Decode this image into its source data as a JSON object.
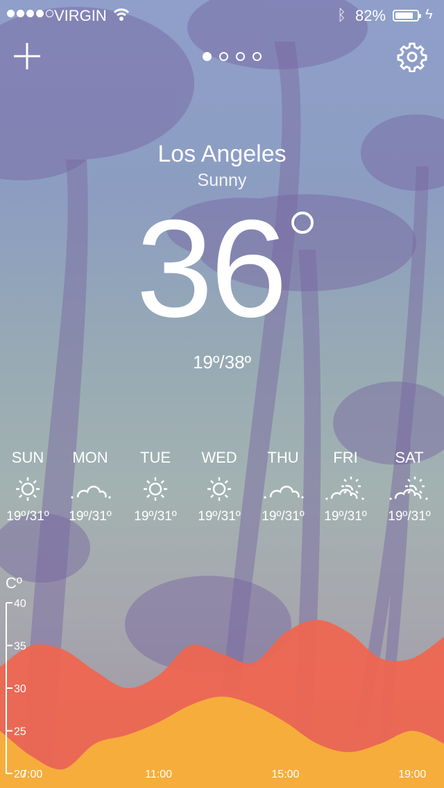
{
  "status_bar": {
    "carrier": "VIRGIN",
    "signal_bars": 4,
    "signal_max": 5,
    "battery_percent": "82%",
    "battery_level": 0.82
  },
  "nav": {
    "add_icon": "plus-icon",
    "settings_icon": "gear-icon",
    "pages": 4,
    "active_page": 0
  },
  "current": {
    "city": "Los Angeles",
    "condition": "Sunny",
    "temperature": "36",
    "range": "19º/38º"
  },
  "forecast": [
    {
      "day": "SUN",
      "icon": "sun-icon",
      "range": "19º/31º"
    },
    {
      "day": "MON",
      "icon": "cloud-icon",
      "range": "19º/31º"
    },
    {
      "day": "TUE",
      "icon": "sun-icon",
      "range": "19º/31º"
    },
    {
      "day": "WED",
      "icon": "sun-icon",
      "range": "19º/31º"
    },
    {
      "day": "THU",
      "icon": "cloud-icon",
      "range": "19º/31º"
    },
    {
      "day": "FRI",
      "icon": "partly-cloudy-icon",
      "range": "19º/31º"
    },
    {
      "day": "SAT",
      "icon": "partly-cloudy-icon",
      "range": "19º/31º"
    }
  ],
  "chart_data": {
    "type": "area",
    "ylabel": "Cº",
    "ylim": [
      20,
      40
    ],
    "yticks": [
      "40",
      "35",
      "30",
      "25",
      "20"
    ],
    "xtick_labels": [
      {
        "x": 7,
        "label": "7:00"
      },
      {
        "x": 11,
        "label": "11:00"
      },
      {
        "x": 15,
        "label": "15:00"
      },
      {
        "x": 19,
        "label": "19:00"
      }
    ],
    "x": [
      6,
      7,
      8,
      9,
      10,
      11,
      12,
      13,
      14,
      15,
      16,
      17,
      18,
      19,
      20
    ],
    "series": [
      {
        "color": "#f0654f",
        "values": [
          32.5,
          35,
          34.5,
          32,
          30,
          31.5,
          35,
          34,
          33,
          36.5,
          38,
          36.5,
          33.5,
          33.5,
          36
        ]
      },
      {
        "color": "#f6b33a",
        "values": [
          25,
          22,
          20.5,
          23.5,
          24.5,
          26,
          28,
          29,
          28,
          26,
          23.5,
          22.5,
          23.5,
          25,
          23.5
        ]
      }
    ],
    "colors": {
      "high": "#f0654f",
      "low": "#f6b33a"
    }
  }
}
